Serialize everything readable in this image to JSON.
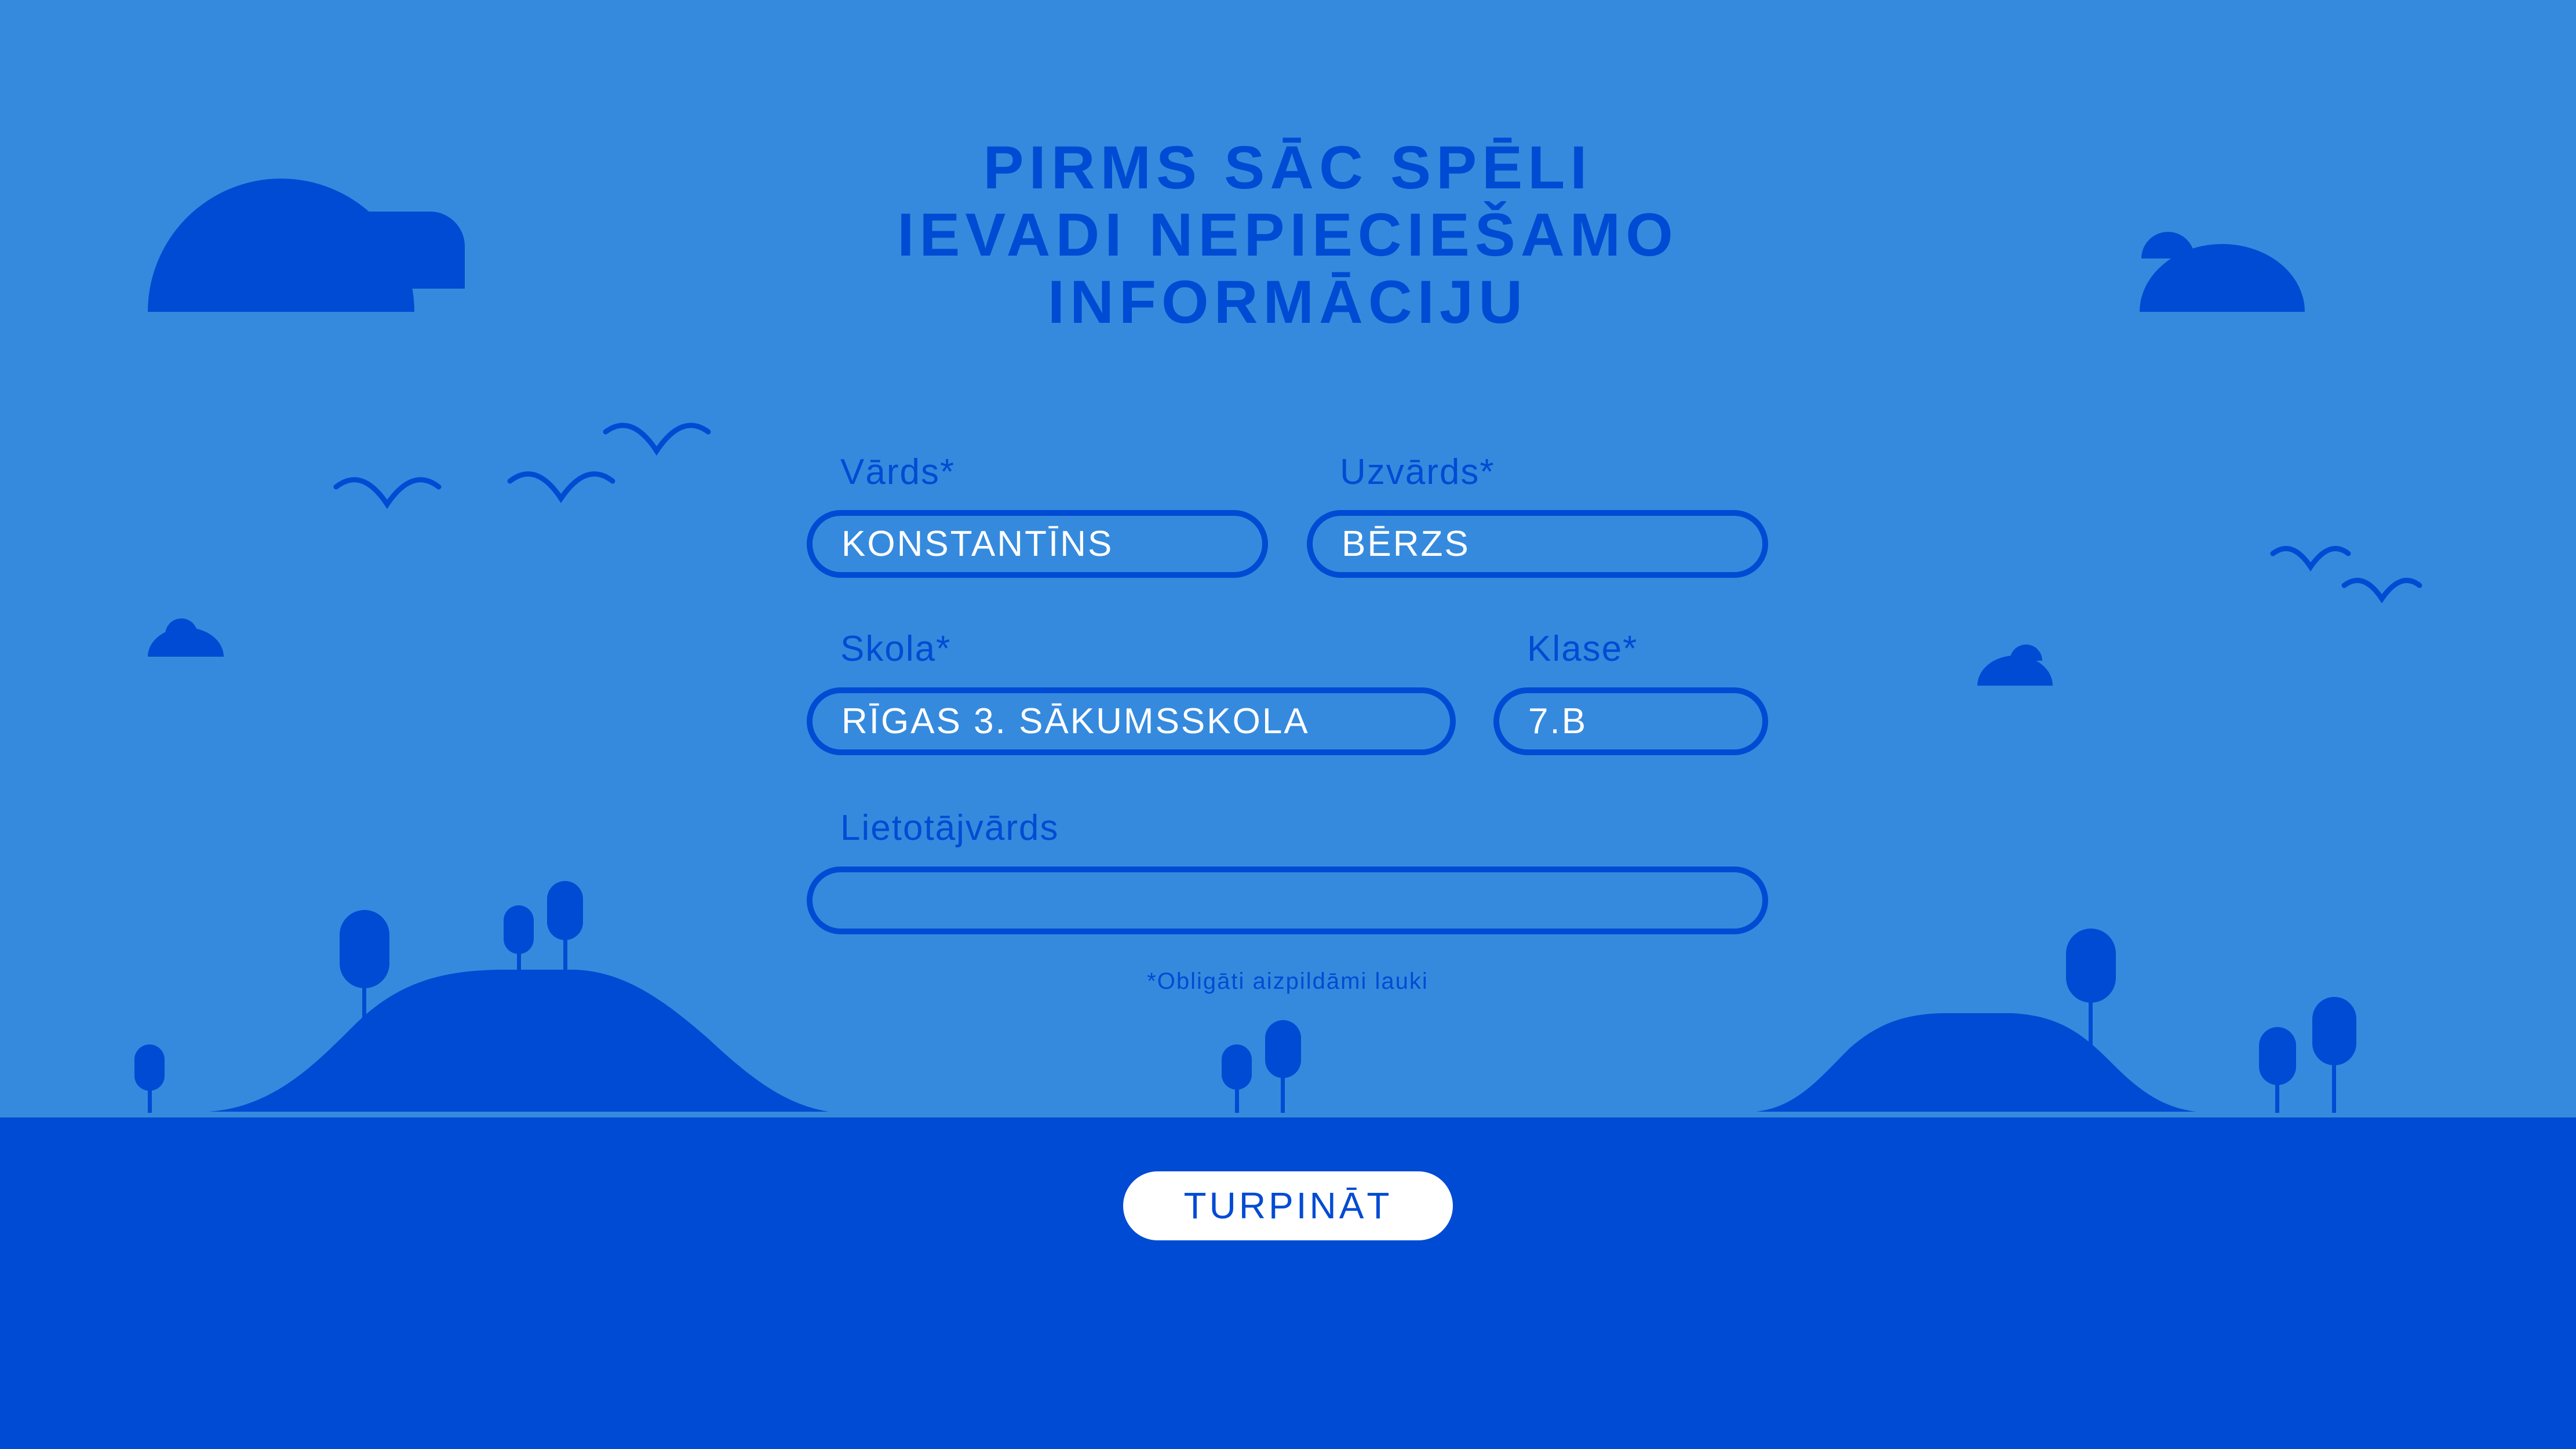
{
  "title": {
    "line1": "PIRMS SĀC SPĒLI",
    "line2": "IEVADI NEPIECIEŠAMO",
    "line3": "INFORMĀCIJU"
  },
  "form": {
    "first_name": {
      "label": "Vārds*",
      "value": "KONSTANTĪNS"
    },
    "last_name": {
      "label": "Uzvārds*",
      "value": "BĒRZS"
    },
    "school": {
      "label": "Skola*",
      "value": "RĪGAS 3. SĀKUMSSKOLA"
    },
    "class": {
      "label": "Klase*",
      "value": "7.B"
    },
    "username": {
      "label": "Lietotājvārds",
      "value": ""
    },
    "required_note": "*Obligāti aizpildāmi lauki"
  },
  "continue_button": {
    "label": "TURPINĀT"
  },
  "colors": {
    "sky": "#358ade",
    "ground": "#004bd3",
    "shapes": "#004bd3",
    "field_text": "#ffffff",
    "button_bg": "#ffffff",
    "button_text": "#004bd3"
  },
  "decorations": {
    "icons": [
      "cloud-icon",
      "bird-icon",
      "hill-icon",
      "tree-icon"
    ]
  }
}
